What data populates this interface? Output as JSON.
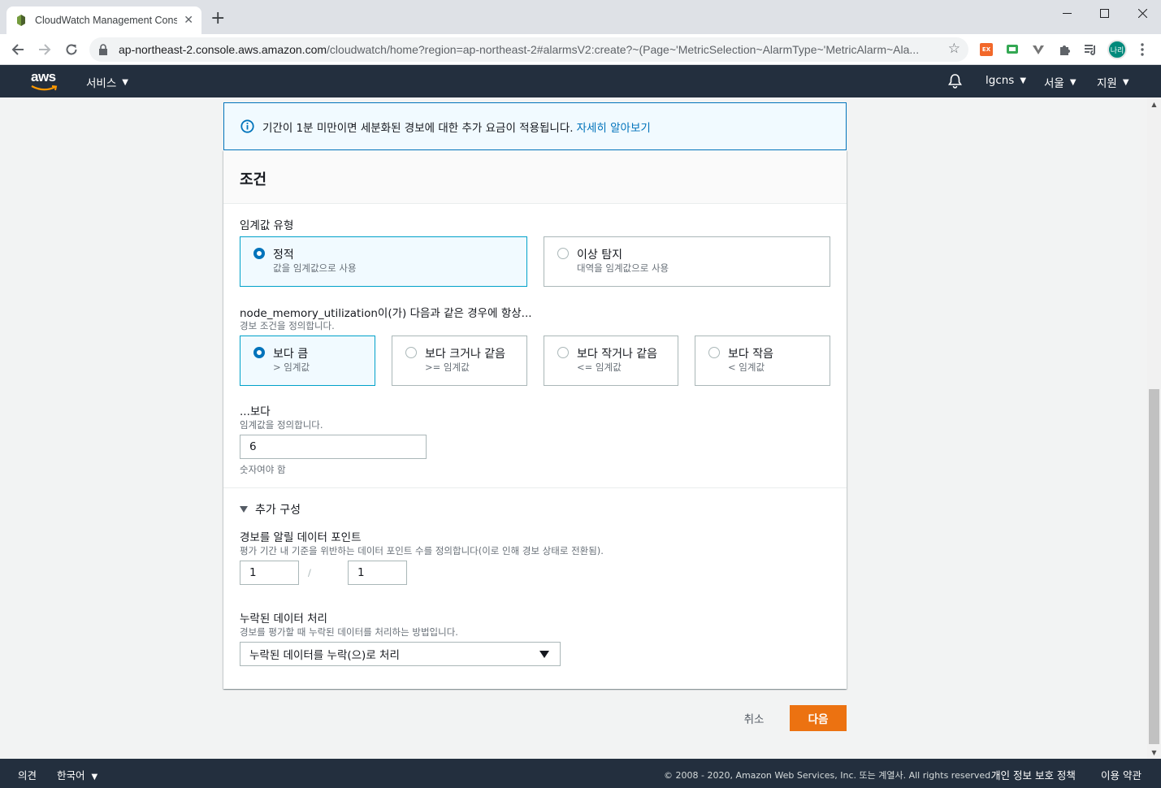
{
  "browser": {
    "tab_title": "CloudWatch Management Cons",
    "url_host": "ap-northeast-2.console.aws.amazon.com",
    "url_path": "/cloudwatch/home?region=ap-northeast-2#alarmsV2:create?~(Page~'MetricSelection~AlarmType~'MetricAlarm~Ala...",
    "profile_label": "나리",
    "ext_label": "EX"
  },
  "aws_nav": {
    "logo_text": "aws",
    "services_label": "서비스",
    "account_label": "lgcns",
    "region_label": "서울",
    "support_label": "지원"
  },
  "info_banner": {
    "message": "기간이 1분 미만이면 세분화된 경보에 대한 추가 요금이 적용됩니다.",
    "link_text": "자세히 알아보기"
  },
  "conditions": {
    "title": "조건",
    "threshold_type": {
      "label": "임계값 유형",
      "options": [
        {
          "title": "정적",
          "subtitle": "값을 임계값으로 사용",
          "selected": true
        },
        {
          "title": "이상 탐지",
          "subtitle": "대역을 임계값으로 사용",
          "selected": false
        }
      ]
    },
    "comparison": {
      "label": "node_memory_utilization이(가) 다음과 같은 경우에 항상...",
      "description": "경보 조건을 정의합니다.",
      "options": [
        {
          "title": "보다 큼",
          "subtitle": "> 임계값",
          "selected": true
        },
        {
          "title": "보다 크거나 같음",
          "subtitle": ">= 임계값",
          "selected": false
        },
        {
          "title": "보다 작거나 같음",
          "subtitle": "<= 임계값",
          "selected": false
        },
        {
          "title": "보다 작음",
          "subtitle": "< 임계값",
          "selected": false
        }
      ]
    },
    "threshold": {
      "label": "...보다",
      "description": "임계값을 정의합니다.",
      "value": "6",
      "hint": "숫자여야 함"
    },
    "additional": {
      "label": "추가 구성",
      "datapoints": {
        "label": "경보를 알릴 데이터 포인트",
        "description": "평가 기간 내 기준을 위반하는 데이터 포인트 수를 정의합니다(이로 인해 경보 상태로 전환됨).",
        "value1": "1",
        "separator": "/",
        "value2": "1"
      },
      "missing_data": {
        "label": "누락된 데이터 처리",
        "description": "경보를 평가할 때 누락된 데이터를 처리하는 방법입니다.",
        "selected": "누락된 데이터를 누락(으)로 처리"
      }
    }
  },
  "actions": {
    "cancel": "취소",
    "next": "다음"
  },
  "footer": {
    "feedback": "의견",
    "language": "한국어",
    "copyright": "© 2008 - 2020, Amazon Web Services, Inc. 또는 계열사. All rights reserved.",
    "privacy": "개인 정보 보호 정책",
    "terms": "이용 약관"
  },
  "colors": {
    "aws_nav": "#232f3e",
    "primary_button": "#ec7211",
    "link": "#0073bb",
    "selected_tile_border": "#00a1c9",
    "selected_tile_bg": "#f1faff"
  }
}
